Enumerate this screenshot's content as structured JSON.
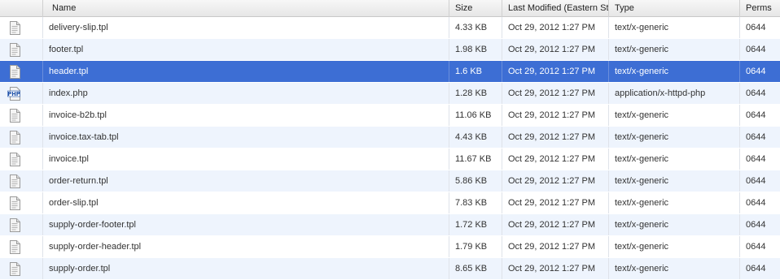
{
  "columns": {
    "name": "Name",
    "size": "Size",
    "modified": "Last Modified (Eastern St",
    "type": "Type",
    "perms": "Perms"
  },
  "selected_index": 2,
  "files": [
    {
      "name": "delivery-slip.tpl",
      "size": "4.33 KB",
      "modified": "Oct 29, 2012 1:27 PM",
      "type": "text/x-generic",
      "perms": "0644",
      "icon": "document-icon"
    },
    {
      "name": "footer.tpl",
      "size": "1.98 KB",
      "modified": "Oct 29, 2012 1:27 PM",
      "type": "text/x-generic",
      "perms": "0644",
      "icon": "document-icon"
    },
    {
      "name": "header.tpl",
      "size": "1.6 KB",
      "modified": "Oct 29, 2012 1:27 PM",
      "type": "text/x-generic",
      "perms": "0644",
      "icon": "document-icon"
    },
    {
      "name": "index.php",
      "size": "1.28 KB",
      "modified": "Oct 29, 2012 1:27 PM",
      "type": "application/x-httpd-php",
      "perms": "0644",
      "icon": "php-file-icon"
    },
    {
      "name": "invoice-b2b.tpl",
      "size": "11.06 KB",
      "modified": "Oct 29, 2012 1:27 PM",
      "type": "text/x-generic",
      "perms": "0644",
      "icon": "document-icon"
    },
    {
      "name": "invoice.tax-tab.tpl",
      "size": "4.43 KB",
      "modified": "Oct 29, 2012 1:27 PM",
      "type": "text/x-generic",
      "perms": "0644",
      "icon": "document-icon"
    },
    {
      "name": "invoice.tpl",
      "size": "11.67 KB",
      "modified": "Oct 29, 2012 1:27 PM",
      "type": "text/x-generic",
      "perms": "0644",
      "icon": "document-icon"
    },
    {
      "name": "order-return.tpl",
      "size": "5.86 KB",
      "modified": "Oct 29, 2012 1:27 PM",
      "type": "text/x-generic",
      "perms": "0644",
      "icon": "document-icon"
    },
    {
      "name": "order-slip.tpl",
      "size": "7.83 KB",
      "modified": "Oct 29, 2012 1:27 PM",
      "type": "text/x-generic",
      "perms": "0644",
      "icon": "document-icon"
    },
    {
      "name": "supply-order-footer.tpl",
      "size": "1.72 KB",
      "modified": "Oct 29, 2012 1:27 PM",
      "type": "text/x-generic",
      "perms": "0644",
      "icon": "document-icon"
    },
    {
      "name": "supply-order-header.tpl",
      "size": "1.79 KB",
      "modified": "Oct 29, 2012 1:27 PM",
      "type": "text/x-generic",
      "perms": "0644",
      "icon": "document-icon"
    },
    {
      "name": "supply-order.tpl",
      "size": "8.65 KB",
      "modified": "Oct 29, 2012 1:27 PM",
      "type": "text/x-generic",
      "perms": "0644",
      "icon": "document-icon"
    }
  ],
  "colors": {
    "selected_row": "#3d6ed4",
    "alt_row": "#eef4fd",
    "php_icon": "#1c4fa8"
  }
}
